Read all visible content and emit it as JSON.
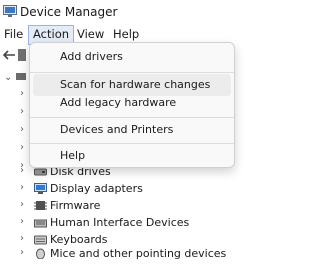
{
  "window": {
    "title": "Device Manager"
  },
  "menubar": {
    "items": [
      "File",
      "Action",
      "View",
      "Help"
    ]
  },
  "action_menu": {
    "items": [
      "Add drivers",
      "Scan for hardware changes",
      "Add legacy hardware",
      "Devices and Printers",
      "Help"
    ]
  },
  "tree": {
    "items": [
      {
        "label": "Disk drives",
        "icon": "disk-drive-icon"
      },
      {
        "label": "Display adapters",
        "icon": "display-adapter-icon"
      },
      {
        "label": "Firmware",
        "icon": "firmware-icon"
      },
      {
        "label": "Human Interface Devices",
        "icon": "hid-icon"
      },
      {
        "label": "Keyboards",
        "icon": "keyboard-icon"
      },
      {
        "label": "Mice and other pointing devices",
        "icon": "mouse-icon"
      }
    ]
  },
  "colors": {
    "menu_active_bg": "#e4ecf7",
    "menu_active_border": "#99b4e0",
    "dropdown_bg": "#f9f9f9"
  }
}
